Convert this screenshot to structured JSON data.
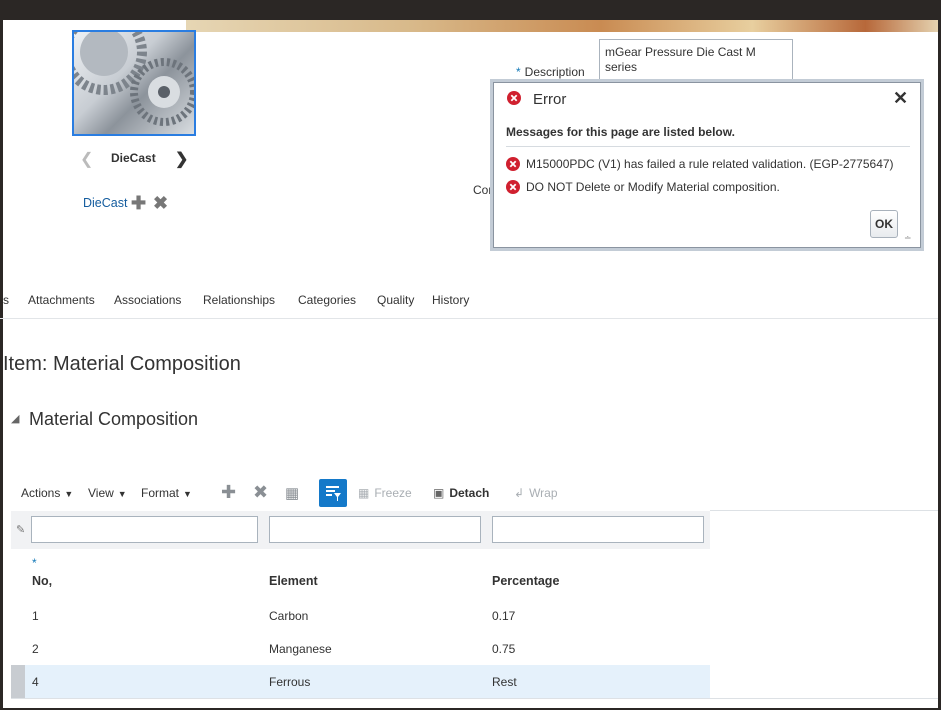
{
  "item_image": {
    "caption": "DieCast"
  },
  "image_link": {
    "label": "DieCast"
  },
  "description": {
    "label": "Description",
    "value": "mGear Pressure Die Cast M series"
  },
  "partial_label": "Con",
  "error_dialog": {
    "title": "Error",
    "subtitle": "Messages for this page are listed below.",
    "messages": [
      "M15000PDC (V1) has failed a rule related validation. (EGP-2775647)",
      "DO NOT Delete or Modify Material composition."
    ],
    "ok_label": "OK"
  },
  "tabs": [
    {
      "label": "s"
    },
    {
      "label": "Attachments"
    },
    {
      "label": "Associations"
    },
    {
      "label": "Relationships"
    },
    {
      "label": "Categories"
    },
    {
      "label": "Quality"
    },
    {
      "label": "History"
    }
  ],
  "page_title": "Item: Material Composition",
  "section_title": "Material Composition",
  "toolbar": {
    "actions": "Actions",
    "view": "View",
    "format": "Format",
    "freeze": "Freeze",
    "detach": "Detach",
    "wrap": "Wrap"
  },
  "table": {
    "columns": [
      "No,",
      "Element",
      "Percentage"
    ],
    "required_mark": "*",
    "rows": [
      {
        "no": "1",
        "element": "Carbon",
        "percentage": "0.17"
      },
      {
        "no": "2",
        "element": "Manganese",
        "percentage": "0.75"
      },
      {
        "no": "4",
        "element": "Ferrous",
        "percentage": "Rest"
      }
    ]
  },
  "colors": {
    "accent": "#1479c9",
    "error": "#d0202f",
    "selected_row": "#e5f1fb"
  }
}
